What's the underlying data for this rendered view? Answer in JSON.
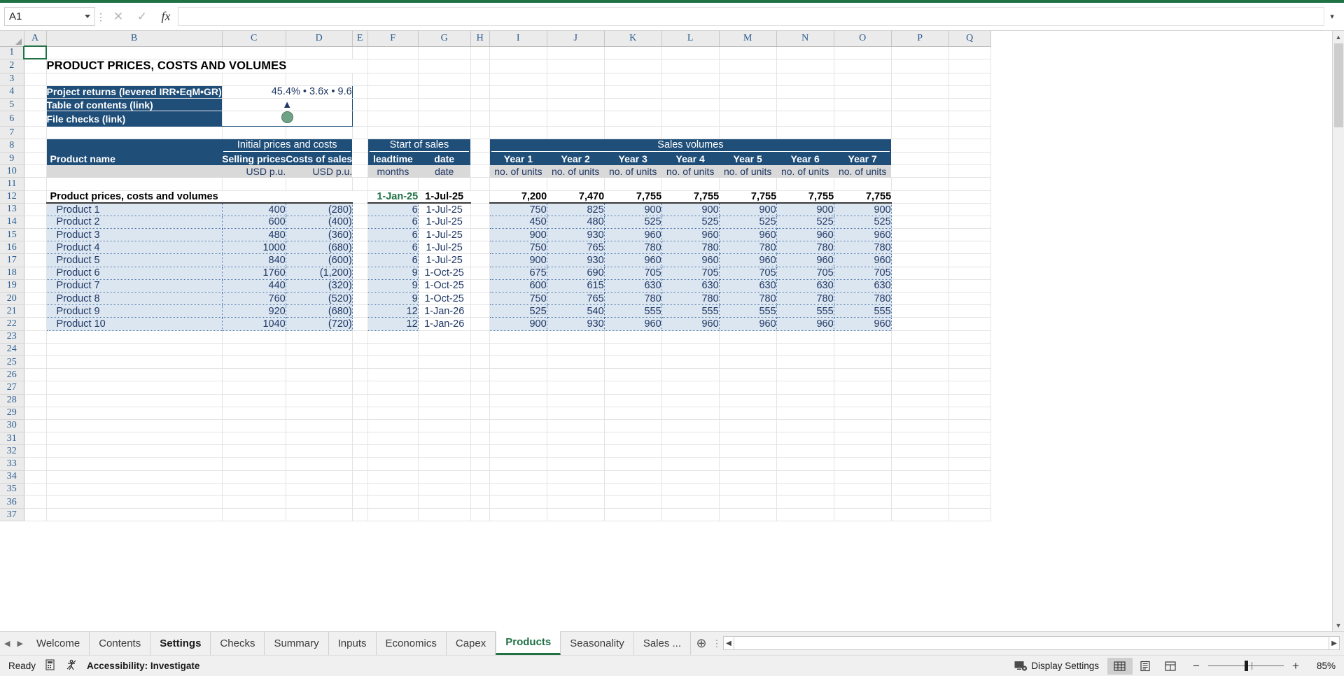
{
  "app": {
    "name_box_value": "A1",
    "formula_value": "",
    "cancel_icon": "close-icon",
    "confirm_icon": "check-icon",
    "function_icon": "fx-icon"
  },
  "columns": [
    "A",
    "B",
    "C",
    "D",
    "E",
    "F",
    "G",
    "H",
    "I",
    "J",
    "K",
    "L",
    "M",
    "N",
    "O",
    "P",
    "Q"
  ],
  "rows": [
    1,
    2,
    3,
    4,
    5,
    6,
    7,
    8,
    9,
    10,
    11,
    12,
    13,
    14,
    15,
    16,
    17,
    18,
    19,
    20,
    21,
    22,
    23,
    24,
    25,
    26,
    27,
    28,
    29,
    30,
    31,
    32,
    33,
    34,
    35,
    36,
    37
  ],
  "sheet": {
    "title": "PRODUCT PRICES, COSTS AND VOLUMES",
    "info_box": {
      "rows": [
        {
          "label": "Project returns (levered IRR•EqM•GR)",
          "value": "45.4% • 3.6x • 9.6"
        },
        {
          "label": "Table of contents (link)",
          "value": "▲"
        },
        {
          "label": "File checks (link)",
          "value": ""
        }
      ]
    },
    "header_groups": {
      "initial": "Initial prices and costs",
      "start_of_sales": "Start of sales",
      "sales_volumes": "Sales volumes"
    },
    "col_headers": {
      "product_name": "Product name",
      "selling_prices": "Selling prices",
      "costs_of_sales": "Costs of sales",
      "leadtime": "leadtime",
      "date": "date",
      "years": [
        "Year 1",
        "Year 2",
        "Year 3",
        "Year 4",
        "Year 5",
        "Year 6",
        "Year 7"
      ]
    },
    "units": {
      "selling_prices": "USD p.u.",
      "costs_of_sales": "USD p.u.",
      "leadtime": "months",
      "date": "date",
      "years": [
        "no. of units",
        "no. of units",
        "no. of units",
        "no. of units",
        "no. of units",
        "no. of units",
        "no. of units"
      ]
    },
    "total_row": {
      "label": "Product prices, costs and volumes",
      "selling_prices": "",
      "costs_of_sales": "",
      "leadtime": "1-Jan-25",
      "date": "1-Jul-25",
      "years": [
        "7,200",
        "7,470",
        "7,755",
        "7,755",
        "7,755",
        "7,755",
        "7,755"
      ]
    },
    "products": [
      {
        "name": "Product 1",
        "selling_price": "400",
        "cost_of_sales": "(280)",
        "leadtime": "6",
        "date": "1-Jul-25",
        "volumes": [
          "750",
          "825",
          "900",
          "900",
          "900",
          "900",
          "900"
        ]
      },
      {
        "name": "Product 2",
        "selling_price": "600",
        "cost_of_sales": "(400)",
        "leadtime": "6",
        "date": "1-Jul-25",
        "volumes": [
          "450",
          "480",
          "525",
          "525",
          "525",
          "525",
          "525"
        ]
      },
      {
        "name": "Product 3",
        "selling_price": "480",
        "cost_of_sales": "(360)",
        "leadtime": "6",
        "date": "1-Jul-25",
        "volumes": [
          "900",
          "930",
          "960",
          "960",
          "960",
          "960",
          "960"
        ]
      },
      {
        "name": "Product 4",
        "selling_price": "1000",
        "cost_of_sales": "(680)",
        "leadtime": "6",
        "date": "1-Jul-25",
        "volumes": [
          "750",
          "765",
          "780",
          "780",
          "780",
          "780",
          "780"
        ]
      },
      {
        "name": "Product 5",
        "selling_price": "840",
        "cost_of_sales": "(600)",
        "leadtime": "6",
        "date": "1-Jul-25",
        "volumes": [
          "900",
          "930",
          "960",
          "960",
          "960",
          "960",
          "960"
        ]
      },
      {
        "name": "Product 6",
        "selling_price": "1760",
        "cost_of_sales": "(1,200)",
        "leadtime": "9",
        "date": "1-Oct-25",
        "volumes": [
          "675",
          "690",
          "705",
          "705",
          "705",
          "705",
          "705"
        ]
      },
      {
        "name": "Product 7",
        "selling_price": "440",
        "cost_of_sales": "(320)",
        "leadtime": "9",
        "date": "1-Oct-25",
        "volumes": [
          "600",
          "615",
          "630",
          "630",
          "630",
          "630",
          "630"
        ]
      },
      {
        "name": "Product 8",
        "selling_price": "760",
        "cost_of_sales": "(520)",
        "leadtime": "9",
        "date": "1-Oct-25",
        "volumes": [
          "750",
          "765",
          "780",
          "780",
          "780",
          "780",
          "780"
        ]
      },
      {
        "name": "Product 9",
        "selling_price": "920",
        "cost_of_sales": "(680)",
        "leadtime": "12",
        "date": "1-Jan-26",
        "volumes": [
          "525",
          "540",
          "555",
          "555",
          "555",
          "555",
          "555"
        ]
      },
      {
        "name": "Product 10",
        "selling_price": "1040",
        "cost_of_sales": "(720)",
        "leadtime": "12",
        "date": "1-Jan-26",
        "volumes": [
          "900",
          "930",
          "960",
          "960",
          "960",
          "960",
          "960"
        ]
      }
    ]
  },
  "tabs": [
    {
      "label": "Welcome",
      "state": "normal"
    },
    {
      "label": "Contents",
      "state": "normal"
    },
    {
      "label": "Settings",
      "state": "bold"
    },
    {
      "label": "Checks",
      "state": "normal"
    },
    {
      "label": "Summary",
      "state": "normal"
    },
    {
      "label": "Inputs",
      "state": "normal"
    },
    {
      "label": "Economics",
      "state": "normal"
    },
    {
      "label": "Capex",
      "state": "normal"
    },
    {
      "label": "Products",
      "state": "active"
    },
    {
      "label": "Seasonality",
      "state": "normal"
    },
    {
      "label": "Sales ...",
      "state": "normal"
    }
  ],
  "tab_add_label": "⊕",
  "status": {
    "ready": "Ready",
    "accessibility": "Accessibility: Investigate",
    "display_settings": "Display Settings",
    "zoom": "85%",
    "zoom_minus": "−",
    "zoom_plus": "+"
  },
  "colors": {
    "navy": "#1f4e79",
    "input_fill": "#dce6f1",
    "unit_fill": "#d9d9d9",
    "excel_green": "#217346",
    "font_blue": "#1f3864"
  }
}
